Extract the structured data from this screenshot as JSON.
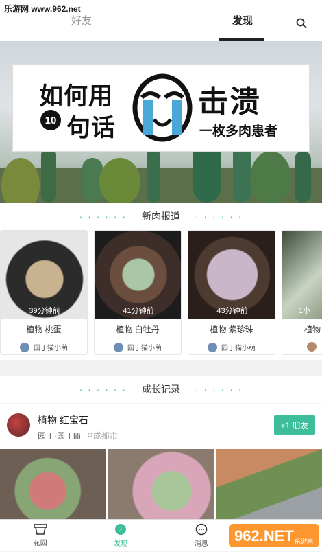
{
  "watermark_top": "乐游网 www.962.net",
  "tabs": [
    {
      "label": "好友"
    },
    {
      "label": "发现"
    }
  ],
  "search_icon": "search-icon",
  "banner": {
    "line1": "如何用",
    "number": "10",
    "line2": "句话",
    "line3": "击溃",
    "line4": "一枚多肉患者"
  },
  "section_new": {
    "title": "新肉报道",
    "dots_left": "· · · · · ·",
    "dots_right": "· · · · · ·"
  },
  "cards": [
    {
      "time": "39分钟前",
      "name": "植物 桃蛋",
      "user": "园丁猫小萌"
    },
    {
      "time": "41分钟前",
      "name": "植物 白牡丹",
      "user": "园丁猫小萌"
    },
    {
      "time": "43分钟前",
      "name": "植物 紫珍珠",
      "user": "园丁猫小萌"
    },
    {
      "time": "1小",
      "name": "植物",
      "user": ""
    }
  ],
  "section_growth": {
    "title": "成长记录",
    "dots_left": "· · · · · ·",
    "dots_right": "· · · · · ·"
  },
  "post": {
    "title": "植物 红宝石",
    "author": "园丁·园丁lili",
    "location": "成都市",
    "follow_label": "+1 朋友"
  },
  "bottom_nav": [
    {
      "label": "花园",
      "icon": "flowerpot-icon"
    },
    {
      "label": "发现",
      "icon": "compass-icon"
    },
    {
      "label": "消息",
      "icon": "chat-icon"
    },
    {
      "label": "",
      "icon": ""
    }
  ],
  "watermark_bottom": {
    "main": "962.NET",
    "sub": "乐游网"
  },
  "colors": {
    "accent": "#3dbd9a",
    "text": "#333333",
    "muted": "#999999"
  }
}
